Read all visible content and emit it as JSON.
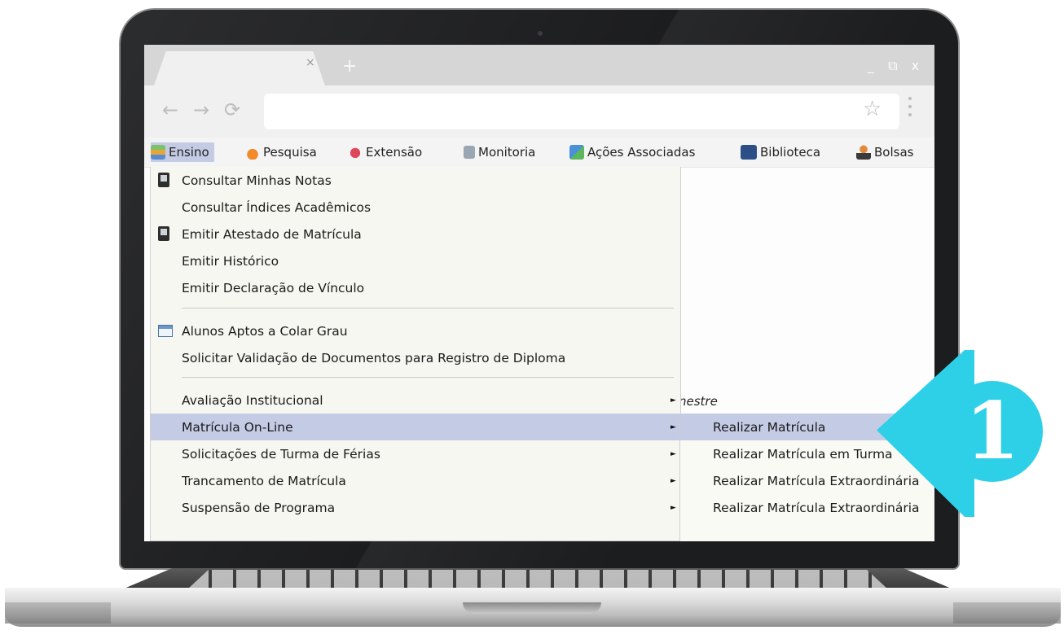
{
  "browser": {
    "tab_close": "×",
    "new_tab": "+",
    "window_controls": "_ ⧉ x",
    "back": "←",
    "forward": "→",
    "reload": "⟳",
    "star": "☆"
  },
  "menubar": {
    "items": [
      {
        "label": "Ensino",
        "icon": "books-icon"
      },
      {
        "label": "Pesquisa",
        "icon": "flask-icon"
      },
      {
        "label": "Extensão",
        "icon": "heart-hands-icon"
      },
      {
        "label": "Monitoria",
        "icon": "monitor-icon"
      },
      {
        "label": "Ações Associadas",
        "icon": "puzzle-icon"
      },
      {
        "label": "Biblioteca",
        "icon": "book-icon"
      },
      {
        "label": "Bolsas",
        "icon": "person-icon"
      }
    ]
  },
  "dropdown": {
    "items": [
      {
        "label": "Consultar Minhas Notas",
        "icon": "mobile-icon"
      },
      {
        "label": "Consultar Índices Acadêmicos"
      },
      {
        "label": "Emitir Atestado de Matrícula",
        "icon": "mobile-icon"
      },
      {
        "label": "Emitir Histórico"
      },
      {
        "label": "Emitir Declaração de Vínculo"
      },
      {
        "label": "Alunos Aptos a Colar Grau",
        "icon": "window-icon"
      },
      {
        "label": "Solicitar Validação de Documentos para Registro de Diploma"
      },
      {
        "label": "Avaliação Institucional",
        "submenu": true
      },
      {
        "label": "Matrícula On-Line",
        "submenu": true,
        "highlighted": true
      },
      {
        "label": "Solicitações de Turma de Férias",
        "submenu": true
      },
      {
        "label": "Trancamento de Matrícula",
        "submenu": true
      },
      {
        "label": "Suspensão de Programa",
        "submenu": true
      }
    ],
    "arrow": "►"
  },
  "submenu": {
    "items": [
      {
        "label": "Realizar Matrícula",
        "highlighted": true
      },
      {
        "label": "Realizar Matrícula em Turma"
      },
      {
        "label": "Realizar Matrícula Extraordinária"
      },
      {
        "label": "Realizar Matrícula Extraordinária"
      }
    ]
  },
  "background_text": "nestre",
  "callout": {
    "number": "1",
    "color": "#2ed0e8"
  },
  "colors": {
    "highlight": "#c4cbe5",
    "menu_bg": "#f7f7f1"
  }
}
